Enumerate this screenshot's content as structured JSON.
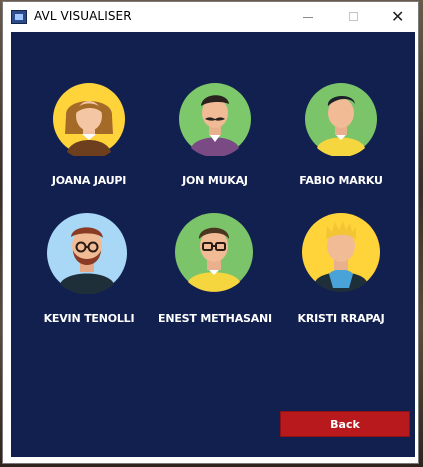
{
  "window": {
    "title": "AVL VISUALISER",
    "controls": {
      "minimize": "minimize",
      "maximize": "maximize",
      "close": "✕"
    }
  },
  "team": [
    {
      "name": "JOANA JAUPI",
      "avatar_bg": "#ffd43a",
      "avatar": "woman-curly-hair-icon"
    },
    {
      "name": "JON MUKAJ",
      "avatar_bg": "#7dc86b",
      "avatar": "man-mustache-icon"
    },
    {
      "name": "FABIO MARKU",
      "avatar_bg": "#7cc46a",
      "avatar": "man-short-hair-icon"
    },
    {
      "name": "KEVIN TENOLLI",
      "avatar_bg": "#a8d8f5",
      "avatar": "man-beard-glasses-icon"
    },
    {
      "name": "ENEST METHASANI",
      "avatar_bg": "#7cc46a",
      "avatar": "man-glasses-icon"
    },
    {
      "name": "KRISTI RRAPAJ",
      "avatar_bg": "#ffd43a",
      "avatar": "man-blond-hair-icon"
    }
  ],
  "actions": {
    "back_label": "Back"
  },
  "colors": {
    "panel": "#12204f",
    "button": "#b7191d"
  }
}
